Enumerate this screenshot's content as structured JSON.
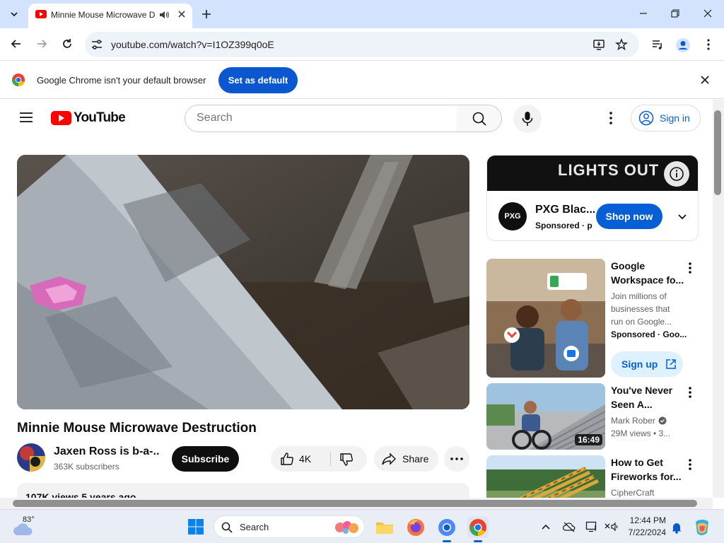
{
  "browser": {
    "tab_title": "Minnie Mouse Microwave D",
    "url": "youtube.com/watch?v=I1OZ399q0oE"
  },
  "infobar": {
    "message": "Google Chrome isn't your default browser",
    "set_default_label": "Set as default"
  },
  "youtube": {
    "logo_text": "YouTube",
    "search_placeholder": "Search",
    "sign_in_label": "Sign in",
    "video": {
      "title": "Minnie Mouse Microwave Destruction",
      "channel_name": "Jaxen Ross is b-a-...",
      "subscribers": "363K subscribers",
      "subscribe_label": "Subscribe",
      "likes": "4K",
      "share_label": "Share",
      "views_date": "107K views  5 years ago"
    },
    "ad": {
      "banner_text": "LIGHTS OUT",
      "logo_text": "PXG",
      "advertiser": "PXG Blac...",
      "sponsored_label": "Sponsored · p",
      "cta": "Shop now"
    },
    "recommendations": [
      {
        "title": "Google Workspace fo...",
        "description": "Join millions of businesses that run on Google...",
        "meta": "Sponsored · Goo...",
        "cta": "Sign up"
      },
      {
        "title": "You've Never Seen A...",
        "channel": "Mark Rober",
        "stats": "29M views  • 3...",
        "duration": "16:49"
      },
      {
        "title": "How to Get Fireworks for...",
        "channel": "CipherCraft"
      }
    ]
  },
  "taskbar": {
    "temperature": "83°",
    "search_label": "Search",
    "time": "12:44 PM",
    "date": "7/22/2024"
  },
  "colors": {
    "chrome_frame": "#d3e3fd",
    "chrome_blue": "#0b57d0",
    "youtube_red": "#ff0000",
    "yt_link_blue": "#065fd4"
  }
}
